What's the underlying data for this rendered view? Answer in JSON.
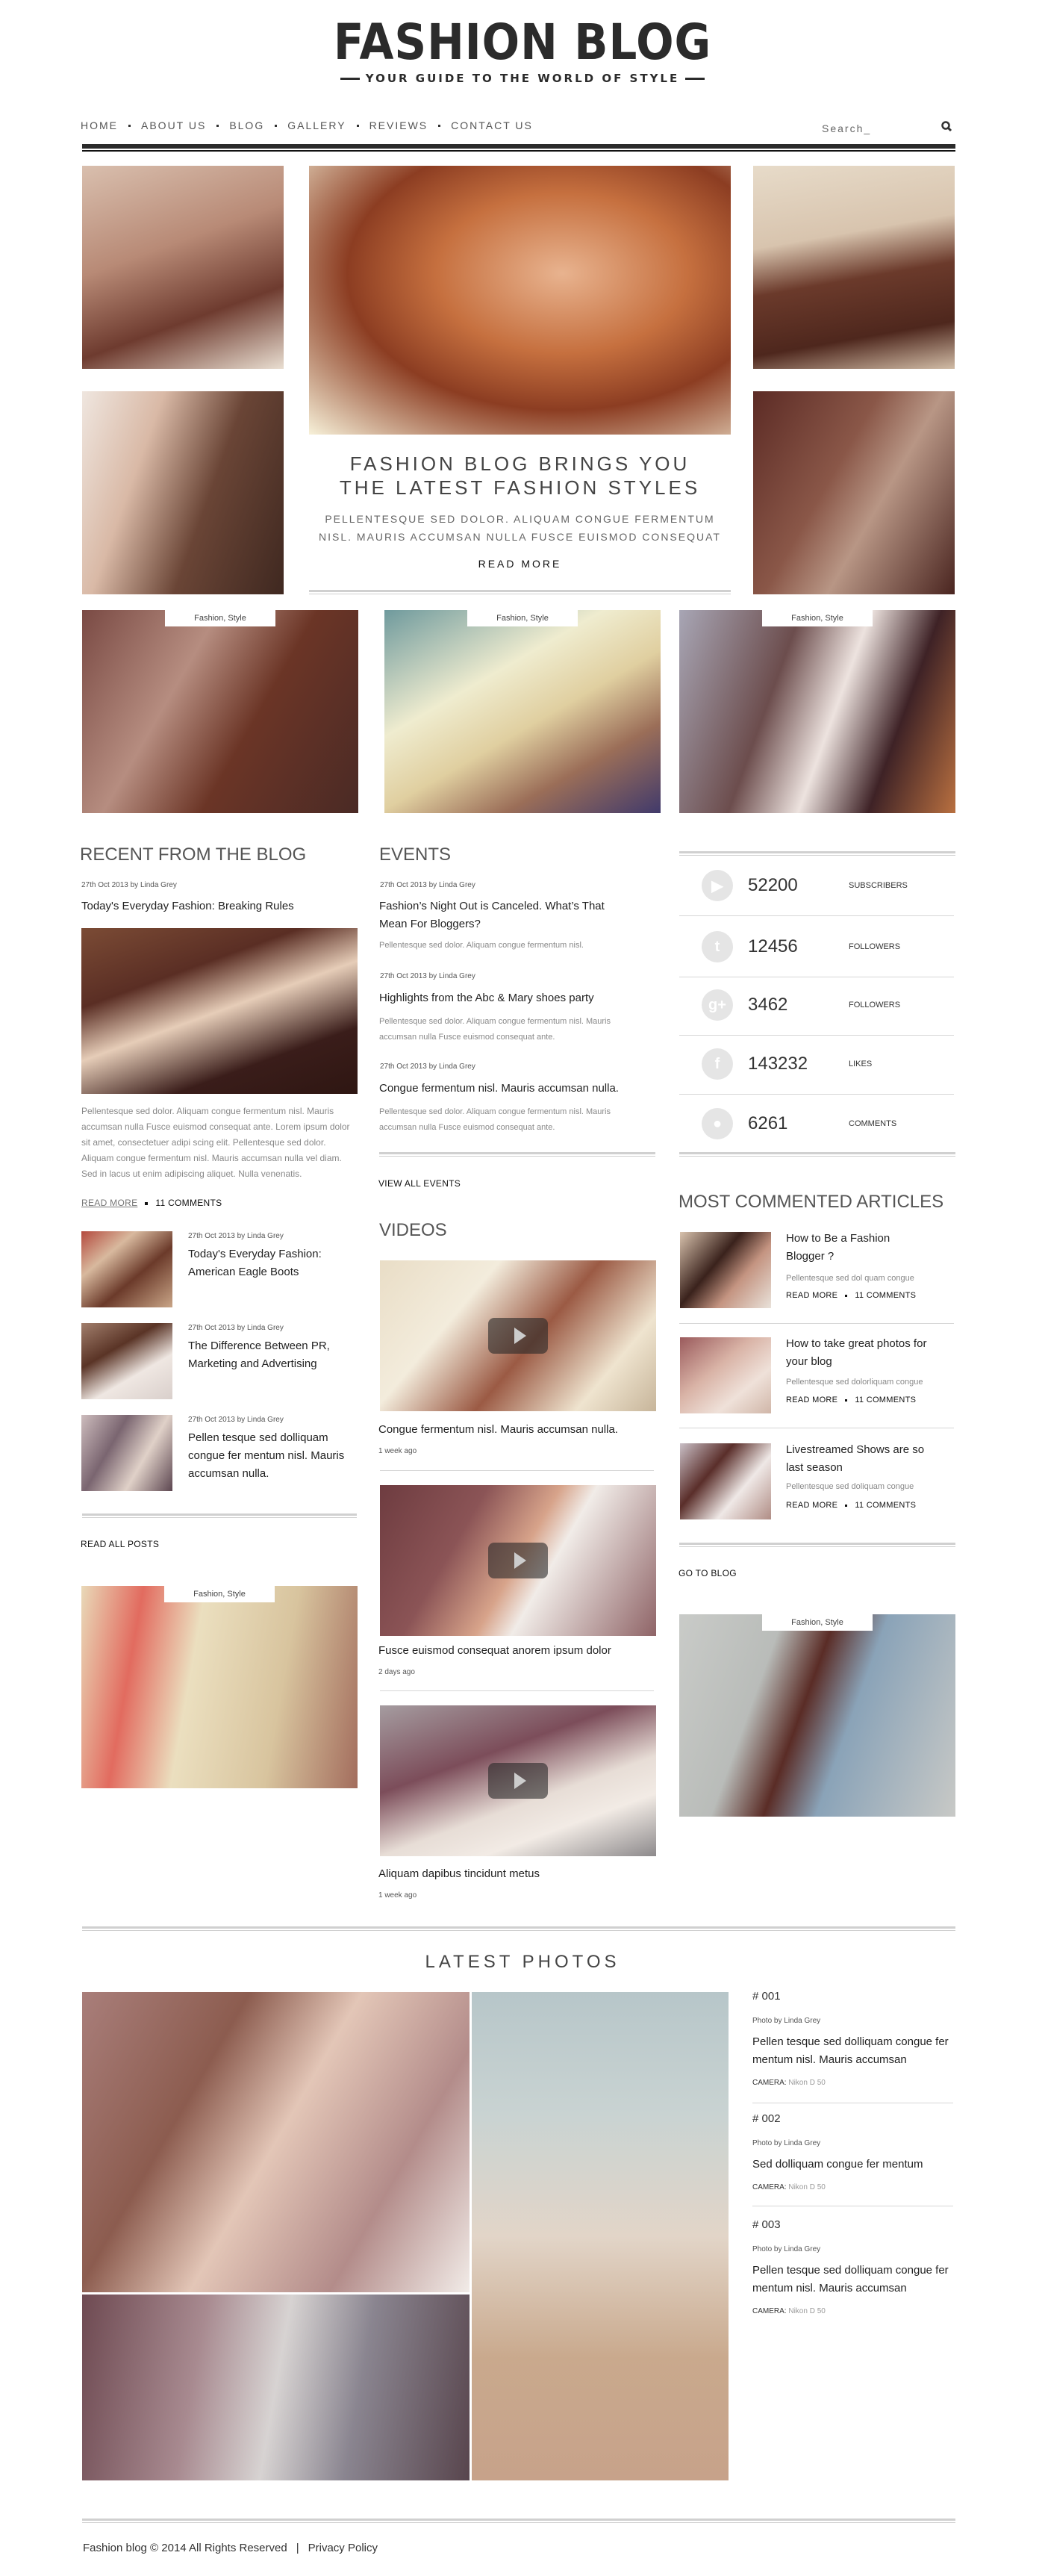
{
  "header": {
    "logo": "FASHION BLOG",
    "tagline": "YOUR GUIDE TO THE WORLD OF STYLE",
    "nav": [
      "HOME",
      "ABOUT US",
      "BLOG",
      "GALLERY",
      "REVIEWS",
      "CONTACT US"
    ],
    "search_placeholder": "Search_"
  },
  "hero": {
    "title_line1": "FASHION BLOG BRINGS YOU",
    "title_line2": "THE LATEST FASHION STYLES",
    "text_line1": "PELLENTESQUE SED DOLOR. ALIQUAM CONGUE FERMENTUM",
    "text_line2": "NISL. MAURIS ACCUMSAN NULLA FUSCE EUISMOD CONSEQUAT",
    "read_more": "READ MORE"
  },
  "tag_label": "Fashion, Style",
  "recent": {
    "heading": "RECENT FROM THE BLOG",
    "featured": {
      "meta": "27th Oct 2013 by Linda Grey",
      "title": "Today's Everyday Fashion: Breaking Rules",
      "text": "Pellentesque sed dolor. Aliquam congue fermentum nisl. Mauris accumsan nulla Fusce euismod consequat ante. Lorem ipsum dolor sit amet, consectetuer adipi scing elit. Pellentesque sed dolor. Aliquam congue fermentum nisl. Mauris accumsan nulla vel diam. Sed in lacus ut enim adipiscing aliquet. Nulla venenatis.",
      "read_more": "READ MORE",
      "comments": "11 COMMENTS"
    },
    "posts": [
      {
        "meta": "27th Oct 2013 by Linda Grey",
        "title": "Today's Everyday Fashion: American Eagle Boots"
      },
      {
        "meta": "27th Oct 2013 by Linda Grey",
        "title": "The Difference Between PR, Marketing and Advertising"
      },
      {
        "meta": "27th Oct 2013 by Linda Grey",
        "title": "Pellen tesque sed dolliquam congue fer mentum nisl. Mauris accumsan nulla."
      }
    ],
    "read_all": "READ ALL POSTS"
  },
  "events": {
    "heading": "EVENTS",
    "items": [
      {
        "meta": "27th Oct 2013 by Linda Grey",
        "title": "Fashion’s Night Out is Canceled. What’s That Mean For Bloggers?",
        "text": "Pellentesque sed dolor. Aliquam congue fermentum nisl."
      },
      {
        "meta": "27th Oct 2013 by Linda Grey",
        "title": "Highlights from the Abc & Mary shoes party",
        "text": "Pellentesque sed dolor. Aliquam congue fermentum nisl. Mauris accumsan nulla Fusce euismod consequat ante."
      },
      {
        "meta": "27th Oct 2013 by Linda Grey",
        "title": "Congue fermentum nisl. Mauris accumsan nulla.",
        "text": "Pellentesque sed dolor. Aliquam congue fermentum nisl. Mauris accumsan nulla Fusce euismod consequat ante."
      }
    ],
    "view_all": "VIEW ALL EVENTS"
  },
  "videos": {
    "heading": "VIDEOS",
    "items": [
      {
        "title": "Congue fermentum nisl. Mauris accumsan nulla.",
        "age": "1 week ago"
      },
      {
        "title": "Fusce euismod consequat anorem ipsum dolor",
        "age": "2 days ago"
      },
      {
        "title": "Aliquam dapibus tincidunt metus",
        "age": "1 week ago"
      }
    ]
  },
  "social": [
    {
      "icon": "youtube-icon",
      "glyph": "▶",
      "count": "52200",
      "label": "SUBSCRIBERS"
    },
    {
      "icon": "twitter-icon",
      "glyph": "t",
      "count": "12456",
      "label": "FOLLOWERS"
    },
    {
      "icon": "google-plus-icon",
      "glyph": "g+",
      "count": "3462",
      "label": "FOLLOWERS"
    },
    {
      "icon": "facebook-icon",
      "glyph": "f",
      "count": "143232",
      "label": "LIKES"
    },
    {
      "icon": "comment-icon",
      "glyph": "●",
      "count": "6261",
      "label": "COMMENTS"
    }
  ],
  "most_commented": {
    "heading": "MOST COMMENTED ARTICLES",
    "items": [
      {
        "title": "How to Be a Fashion Blogger ?",
        "text": "Pellentesque sed dol quam congue",
        "read_more": "READ MORE",
        "comments": "11 COMMENTS"
      },
      {
        "title": "How to take great photos for your blog",
        "text": "Pellentesque sed dolorliquam congue",
        "read_more": "READ MORE",
        "comments": "11 COMMENTS"
      },
      {
        "title": "Livestreamed Shows are so last season",
        "text": "Pellentesque sed doliquam congue",
        "read_more": "READ MORE",
        "comments": "11 COMMENTS"
      }
    ],
    "go_to_blog": "GO TO BLOG"
  },
  "latest_photos": {
    "heading": "LATEST PHOTOS",
    "items": [
      {
        "number": "# 001",
        "author": "Photo by Linda Grey",
        "title": "Pellen tesque sed dolliquam congue fer mentum nisl. Mauris accumsan",
        "camera_label": "CAMERA:",
        "camera": "Nikon D 50"
      },
      {
        "number": "# 002",
        "author": "Photo by Linda Grey",
        "title": "Sed dolliquam congue fer mentum",
        "camera_label": "CAMERA:",
        "camera": "Nikon D 50"
      },
      {
        "number": "# 003",
        "author": "Photo by Linda Grey",
        "title": "Pellen tesque sed dolliquam congue fer mentum nisl. Mauris accumsan",
        "camera_label": "CAMERA:",
        "camera": "Nikon D 50"
      }
    ]
  },
  "footer": {
    "copyright": "Fashion blog © 2014 All Rights Reserved",
    "divider": "|",
    "privacy": "Privacy Policy"
  }
}
